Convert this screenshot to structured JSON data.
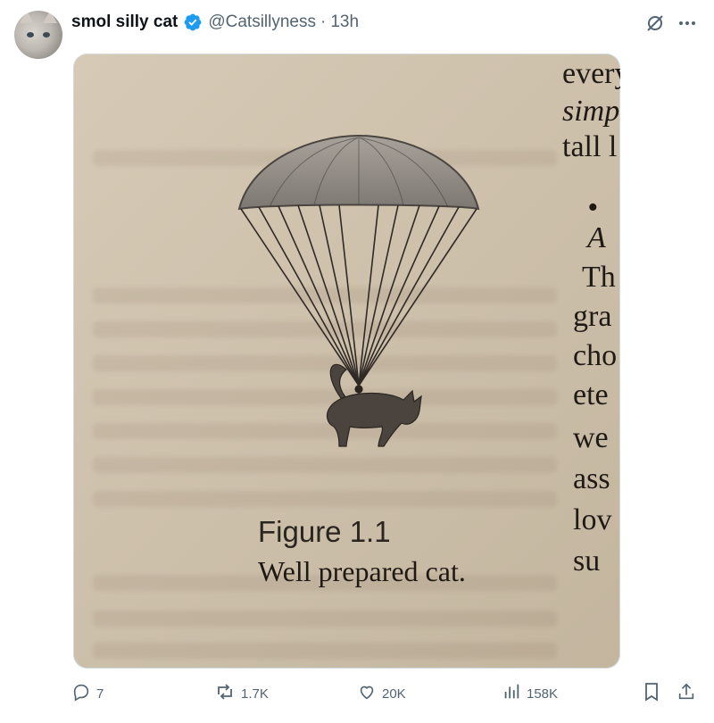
{
  "tweet": {
    "display_name": "smol silly cat",
    "handle": "@Catsillyness",
    "separator": "·",
    "time": "13h",
    "verified": true
  },
  "image": {
    "right_column_words": [
      "every",
      "simp",
      "tall l",
      "• A",
      "Th",
      "gra",
      "cho",
      "ete",
      "we",
      "ass",
      "lov",
      "su"
    ],
    "figure_label": "Figure 1.1",
    "figure_caption": "Well prepared cat."
  },
  "actions": {
    "replies": "7",
    "reposts": "1.7K",
    "likes": "20K",
    "views": "158K"
  },
  "icons": {
    "verified": "verified-badge-icon",
    "grok": "grok-icon",
    "more": "more-icon",
    "reply": "reply-icon",
    "repost": "repost-icon",
    "like": "like-icon",
    "views": "views-icon",
    "bookmark": "bookmark-icon",
    "share": "share-icon"
  },
  "colors": {
    "verified": "#1d9bf0",
    "secondary_text": "#536471",
    "primary_text": "#0f1419"
  }
}
